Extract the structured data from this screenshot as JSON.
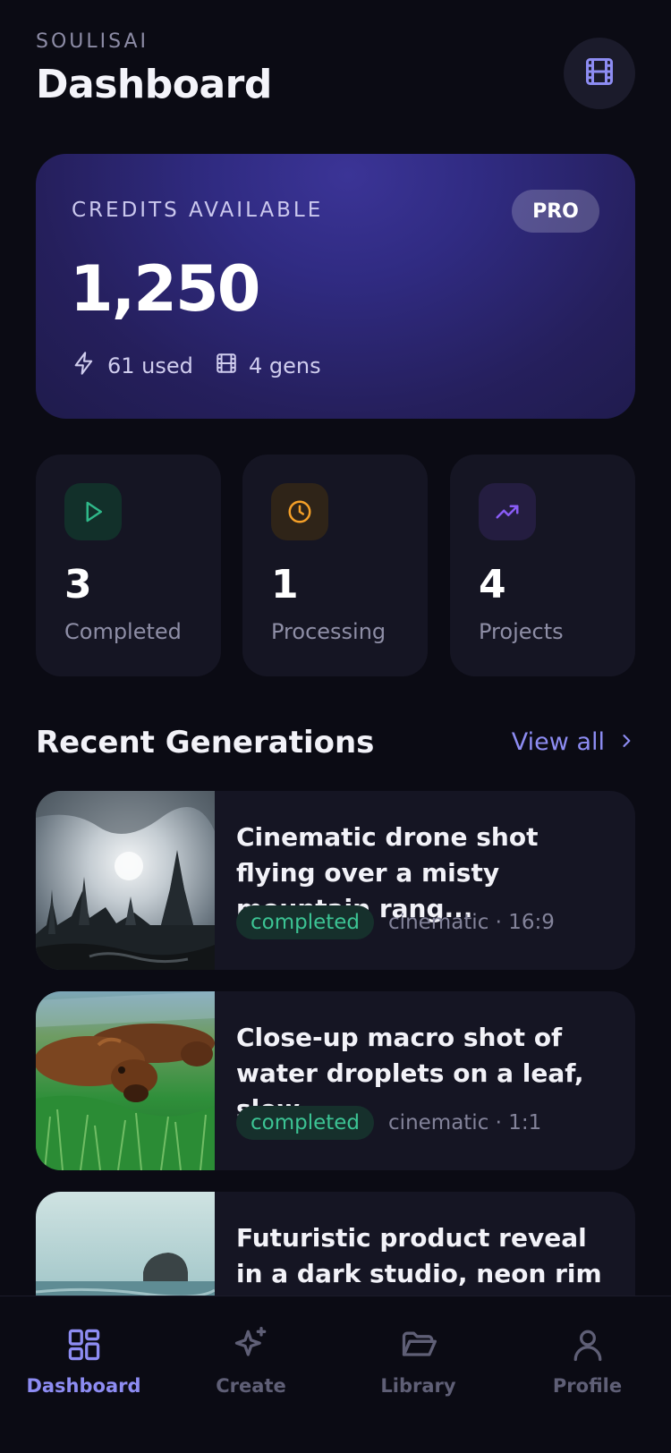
{
  "header": {
    "brand": "SOULISAI",
    "title": "Dashboard",
    "action_icon": "film-icon"
  },
  "credits": {
    "label": "CREDITS AVAILABLE",
    "badge": "PRO",
    "value": "1,250",
    "used": "61 used",
    "gens": "4 gens"
  },
  "stats": [
    {
      "value": "3",
      "label": "Completed",
      "icon": "play-icon",
      "color": "#2fb889"
    },
    {
      "value": "1",
      "label": "Processing",
      "icon": "clock-icon",
      "color": "#f5a028"
    },
    {
      "value": "4",
      "label": "Projects",
      "icon": "trending-up-icon",
      "color": "#8a5cf6"
    }
  ],
  "recent": {
    "title": "Recent Generations",
    "view_all": "View all",
    "items": [
      {
        "title": "Cinematic drone shot flying over a misty mountain rang...",
        "status": "completed",
        "meta": "cinematic · 16:9",
        "thumb": "misty-forest"
      },
      {
        "title": "Close-up macro shot of water droplets on a leaf, slow ...",
        "status": "completed",
        "meta": "cinematic · 1:1",
        "thumb": "dogs-grass"
      },
      {
        "title": "Futuristic product reveal in a dark studio, neon rim ...",
        "status": "",
        "meta": "",
        "thumb": "sea-rock"
      }
    ]
  },
  "nav": {
    "items": [
      {
        "label": "Dashboard",
        "icon": "grid-icon",
        "active": true
      },
      {
        "label": "Create",
        "icon": "sparkle-icon",
        "active": false
      },
      {
        "label": "Library",
        "icon": "folder-icon",
        "active": false
      },
      {
        "label": "Profile",
        "icon": "user-icon",
        "active": false
      }
    ]
  },
  "colors": {
    "accent": "#8d8cf2",
    "background": "#0b0b14",
    "card": "#151523",
    "success": "#3cc494"
  }
}
